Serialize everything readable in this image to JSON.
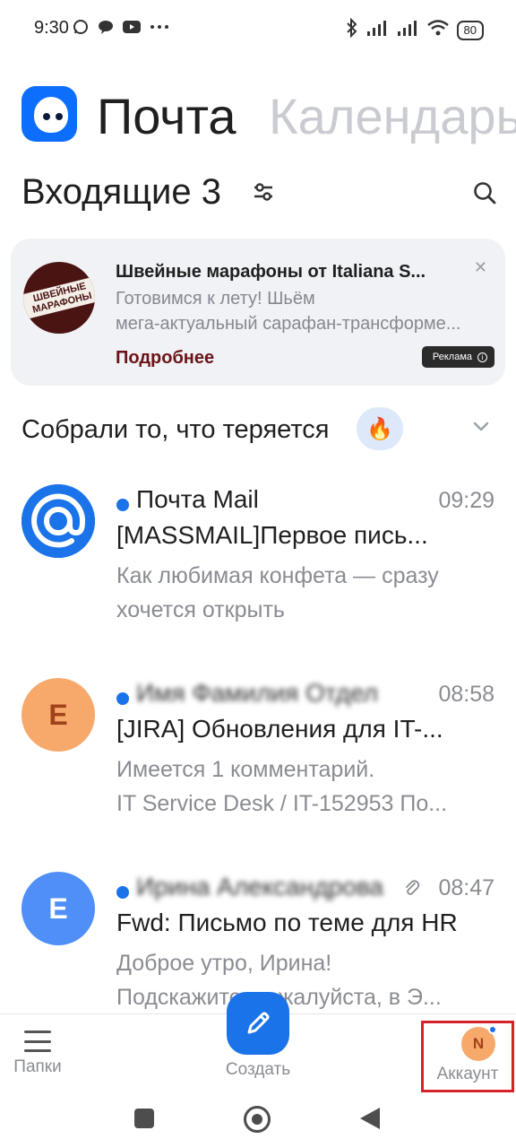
{
  "status_bar": {
    "time": "9:30",
    "left_icons": [
      "whatsapp-icon",
      "chat-bubble-icon",
      "youtube-icon",
      "more-dots-icon"
    ],
    "right_icons": [
      "bluetooth-icon",
      "signal-icon",
      "signal-icon",
      "wifi-icon"
    ],
    "battery": "80"
  },
  "header": {
    "app_tab_active": "Почта",
    "app_tab_inactive": "Календарь"
  },
  "inbox": {
    "title": "Входящие 3"
  },
  "ad": {
    "logo_text": "ШВЕЙНЫЕ МАРАФОНЫ",
    "title": "Швейные марафоны от Italiana S...",
    "line1": "Готовимся к лету!  Шьём",
    "line2": "мега-актуальный сарафан-трансформе...",
    "link": "Подробнее",
    "badge": "Реклама",
    "close": "✕"
  },
  "collected": {
    "title": "Собрали то, что теряется",
    "badge_icon": "🔥"
  },
  "messages": [
    {
      "avatar_letter": "",
      "avatar_color": "#1a73e8",
      "sender": "Почта Mail",
      "time": "09:29",
      "subject": "[MASSMAIL]Первое пись...",
      "preview_line1": "Как любимая конфета — сразу",
      "preview_line2": "хочется открыть"
    },
    {
      "avatar_letter": "E",
      "avatar_color": "#f7a96b",
      "sender": "Имя Фамилия Отдел",
      "time": "08:58",
      "subject": "[JIRA] Обновления для IT-...",
      "preview_line1": "Имеется 1 комментарий.",
      "preview_line2": "IT Service Desk / IT-152953 По..."
    },
    {
      "avatar_letter": "E",
      "avatar_color": "#4f8ff7",
      "sender": "Ирина Александрова",
      "time": "08:47",
      "subject": "Fwd: Письмо по теме для HR",
      "preview_line1": "Доброе утро, Ирина!",
      "preview_line2": "Подскажите, пожалуйста, в Э..."
    }
  ],
  "bottom_nav": {
    "folders": "Папки",
    "compose": "Создать",
    "account": "Аккаунт",
    "account_letter": "N"
  }
}
